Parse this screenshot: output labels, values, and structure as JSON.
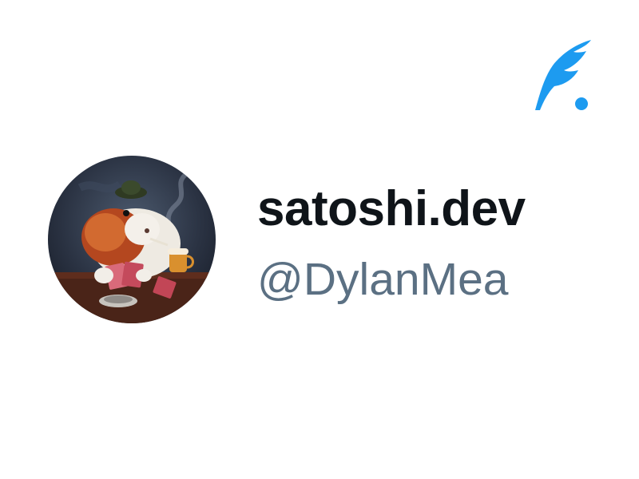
{
  "app": {
    "logo_icon": "feather-pen-icon",
    "accent_color": "#1d9bf0"
  },
  "profile": {
    "avatar_icon": "guinea-pig-painting-avatar",
    "display_name": "satoshi.dev",
    "handle": "@DylanMea"
  },
  "colors": {
    "name": "#0f1419",
    "handle": "#5b7083"
  }
}
